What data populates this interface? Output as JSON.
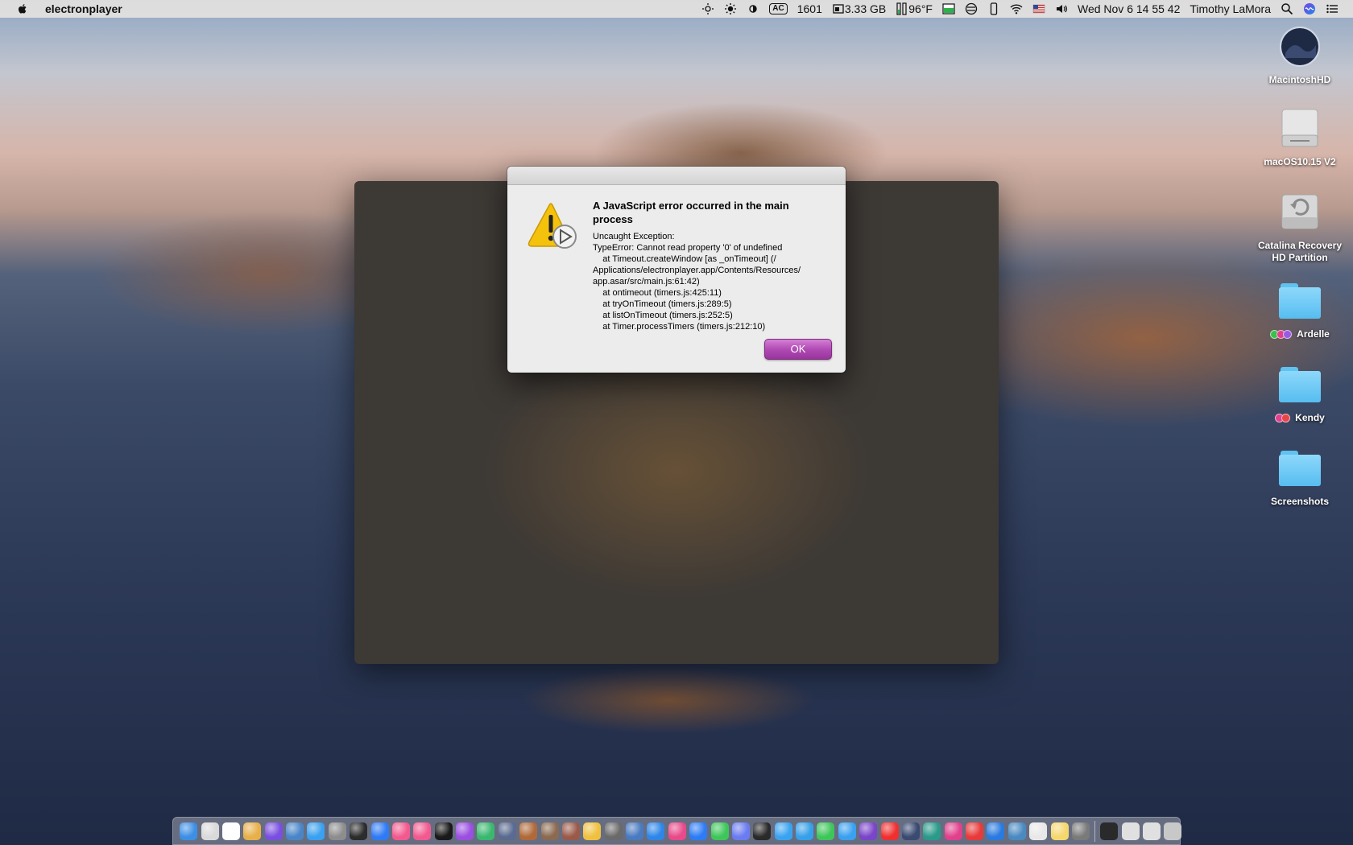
{
  "menubar": {
    "app_name": "electronplayer",
    "ac_label": "AC",
    "cpu_value": "1601",
    "memory_value": "3.33 GB",
    "temperature": "96°F",
    "datetime": "Wed Nov 6  14 55 42",
    "user_name": "Timothy LaMora"
  },
  "alert": {
    "title": "A JavaScript error occurred in the main process",
    "message_lines": "Uncaught Exception:\nTypeError: Cannot read property '0' of undefined\n    at Timeout.createWindow [as _onTimeout] (/\nApplications/electronplayer.app/Contents/Resources/\napp.asar/src/main.js:61:42)\n    at ontimeout (timers.js:425:11)\n    at tryOnTimeout (timers.js:289:5)\n    at listOnTimeout (timers.js:252:5)\n    at Timer.processTimers (timers.js:212:10)",
    "ok_label": "OK",
    "accent_color": "#b14bb4"
  },
  "desktop_icons": [
    {
      "label": "MacintoshHD",
      "icon": "internal-disk-icon"
    },
    {
      "label": "macOS10.15 V2",
      "icon": "external-drive-icon"
    },
    {
      "label": "Catalina Recovery HD Partition",
      "icon": "recovery-disk-icon"
    },
    {
      "label": "Ardelle",
      "icon": "folder-icon",
      "tags": [
        "#39c14b",
        "#e0408c",
        "#9a5be0"
      ]
    },
    {
      "label": "Kendy",
      "icon": "folder-icon",
      "tags": [
        "#e0408c",
        "#e8444a"
      ]
    },
    {
      "label": "Screenshots",
      "icon": "folder-icon",
      "tags": []
    }
  ],
  "dock": {
    "app_colors": [
      "#3d8fe5",
      "#d9d9d9",
      "#ffffff",
      "#e7b04a",
      "#7a4fe0",
      "#4a86c7",
      "#3aa0f0",
      "#8d8d8d",
      "#2c2c2c",
      "#2f7bf5",
      "#f25a8f",
      "#f25a8f",
      "#1a1a1a",
      "#9a4fe0",
      "#39b86f",
      "#5a6a90",
      "#b06a3a",
      "#8a6a50",
      "#9a5a4a",
      "#f0c040",
      "#6a6a6a",
      "#4a7ac0",
      "#2e86e8",
      "#e84a8a",
      "#2d7cf5",
      "#3ec65a",
      "#6b7cf0",
      "#2a2a2a",
      "#3aa3f0",
      "#36a0e8",
      "#3ec65a",
      "#3aa0f0",
      "#7a45c8",
      "#f03030",
      "#3a4a70",
      "#2a9a8a",
      "#e0408c",
      "#e83a3a",
      "#2a7ae0",
      "#4a8ac0",
      "#e8e8e8",
      "#f5d76e",
      "#7a7a7a"
    ],
    "right_colors": [
      "#2a2a2a",
      "#e0e0e0",
      "#e0e0e0",
      "#c8c8c8"
    ]
  }
}
